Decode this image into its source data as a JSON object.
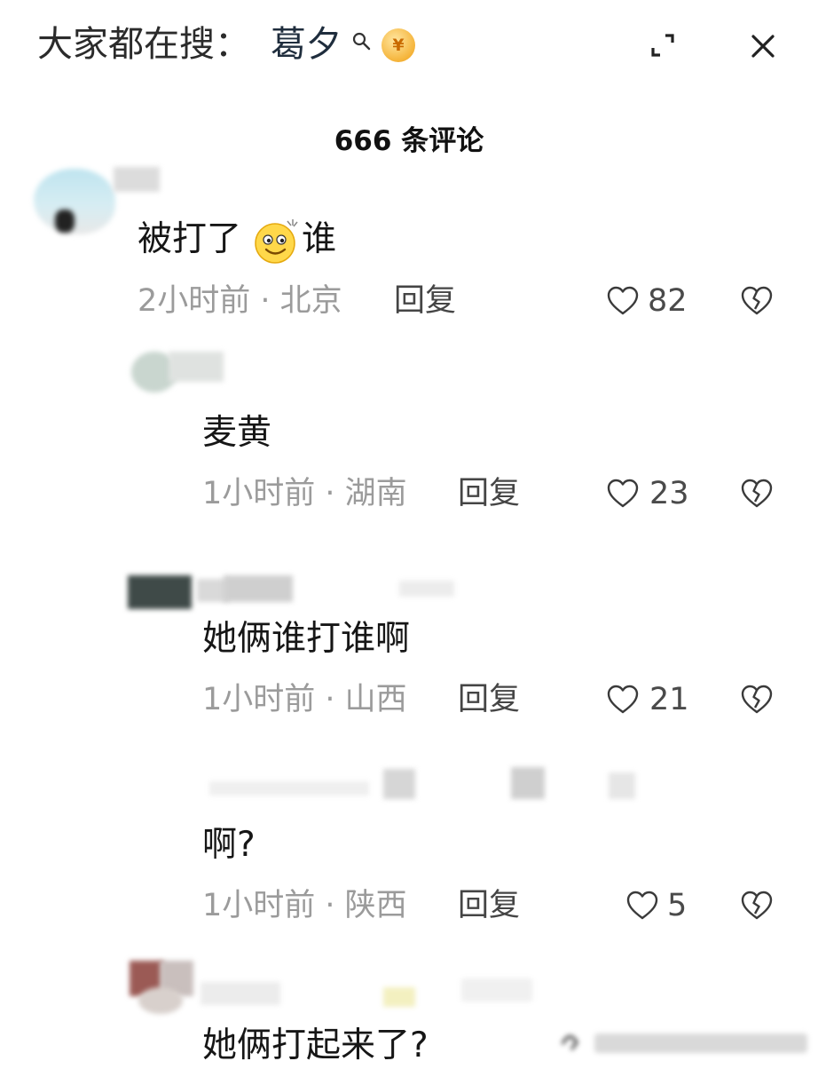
{
  "header": {
    "hot_prefix": "大家都在搜：",
    "hot_term": "葛夕",
    "coin_glyph": "¥",
    "icons": [
      "search-icon",
      "coin-icon",
      "expand-icon",
      "close-icon"
    ]
  },
  "title": "666 条评论",
  "reply_label": "回复",
  "comments": [
    {
      "text_before": "被打了",
      "text_after": " 谁",
      "inline_icon": "grinning-face-emoji",
      "time_loc": "2小时前 · 北京",
      "likes": "82"
    },
    {
      "text": "麦黄",
      "time_loc": "1小时前 · 湖南",
      "likes": "23"
    },
    {
      "text": "她俩谁打谁啊",
      "time_loc": "1小时前 · 山西",
      "likes": "21"
    },
    {
      "text": "啊?",
      "time_loc": "1小时前 · 陕西",
      "likes": "5"
    },
    {
      "text": "她俩打起来了?"
    }
  ],
  "colors": {
    "text": "#161616",
    "meta": "#9b9b9b",
    "background": "#ffffff"
  }
}
